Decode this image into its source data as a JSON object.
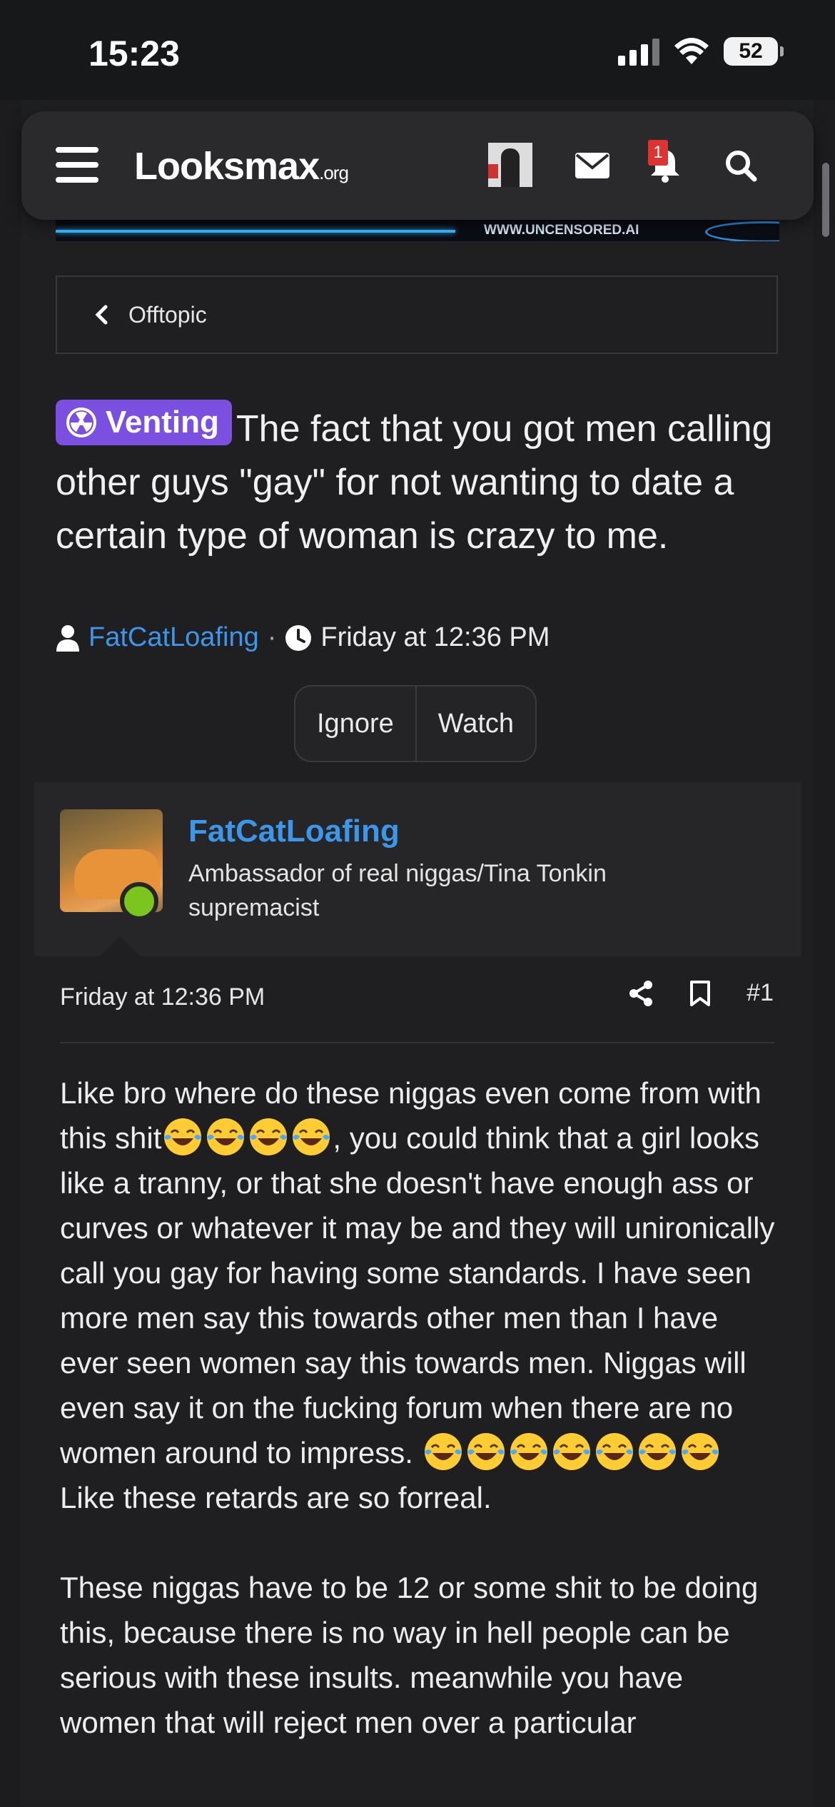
{
  "status_bar": {
    "time": "15:23",
    "battery": "52"
  },
  "header": {
    "logo_main": "Looksmax",
    "logo_suffix": ".org",
    "notification_count": "1"
  },
  "banner": {
    "text": "WWW.UNCENSORED.AI"
  },
  "breadcrumb": {
    "label": "Offtopic"
  },
  "thread": {
    "prefix": "Venting",
    "title": "The fact that you got men calling other guys \"gay\" for not wanting to date a certain type of woman is crazy to me.",
    "author": "FatCatLoafing",
    "separator": "·",
    "date": "Friday at 12:36 PM"
  },
  "actions": {
    "ignore": "Ignore",
    "watch": "Watch"
  },
  "post": {
    "username": "FatCatLoafing",
    "user_title": "Ambassador of real niggas/Tina Tonkin supremacist",
    "date": "Friday at 12:36 PM",
    "number": "#1",
    "p1_a": "Like bro where do these niggas even come from with this shit",
    "p1_b": ", you could think that a girl looks like a tranny, or that she doesn't have enough ass or curves or whatever it may be and they will unironically call you gay for having some standards. I have seen more men say this towards other men than I have ever seen women say this towards men. Niggas will even say it on the fucking forum when there are no women around to impress. ",
    "p1_c": " Like these retards are so forreal.",
    "p2": "These niggas have to be 12 or some shit to be doing this, because there is no way in hell people can be serious with these insults. meanwhile you have women that will reject men over a particular"
  },
  "colors": {
    "accent": "#3c97ea",
    "prefix_bg": "#7b4fe0",
    "online": "#7bc51e",
    "badge": "#dd3333"
  },
  "icons": [
    "hamburger-icon",
    "mail-icon",
    "bell-icon",
    "search-icon",
    "chevron-left-icon",
    "radioactive-icon",
    "user-icon",
    "clock-icon",
    "share-icon",
    "bookmark-icon",
    "laughing-emoji-icon"
  ]
}
